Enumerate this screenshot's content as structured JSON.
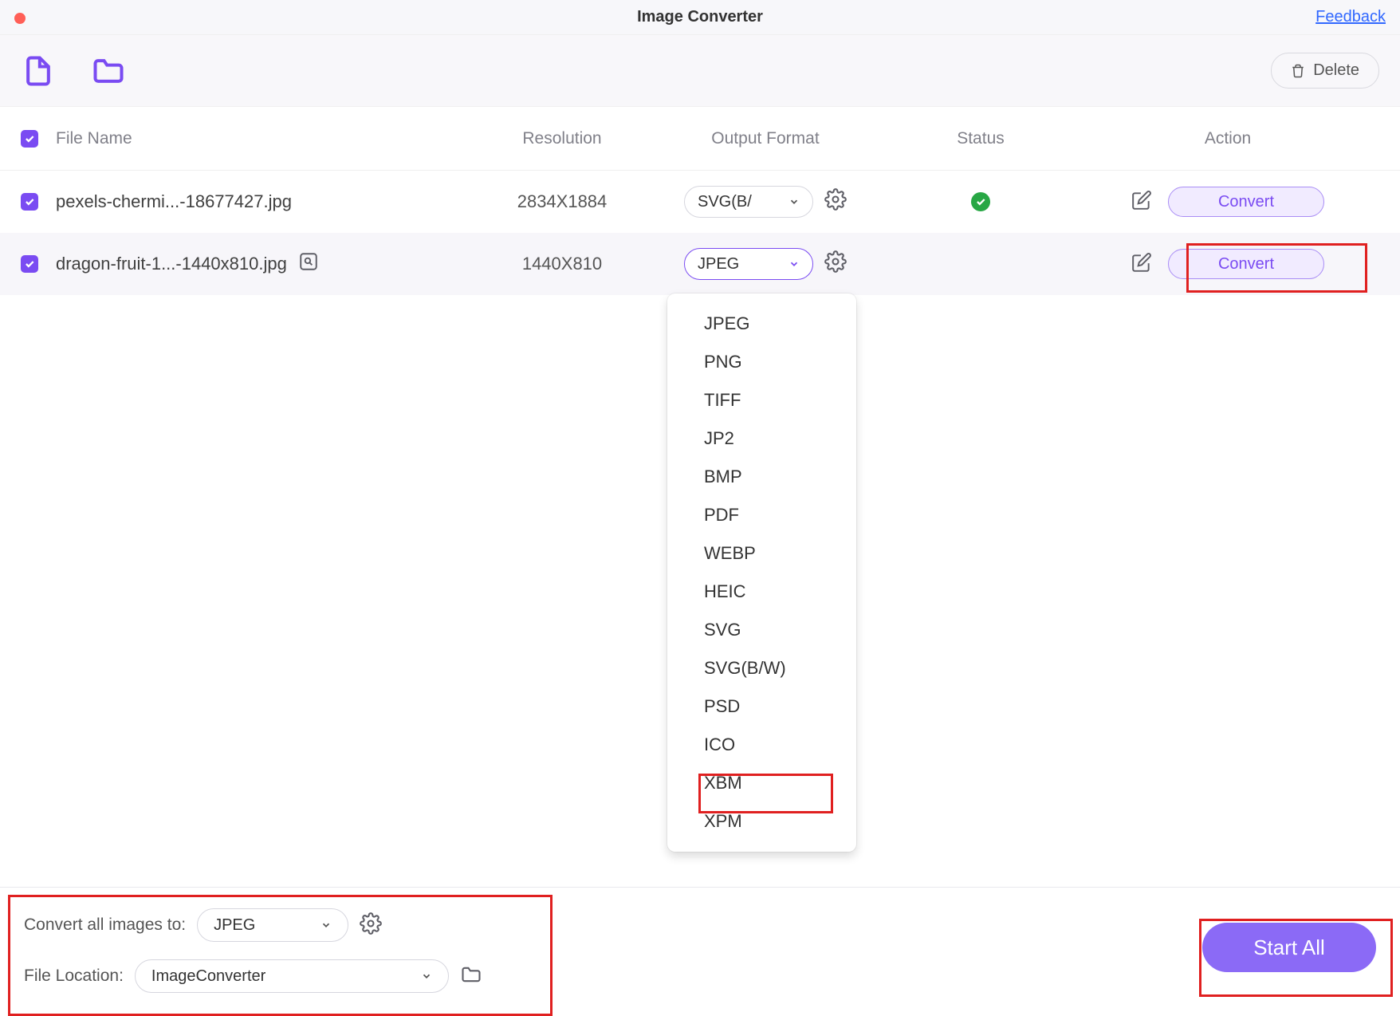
{
  "window": {
    "title": "Image Converter",
    "feedback": "Feedback"
  },
  "toolbar": {
    "delete_label": "Delete"
  },
  "columns": {
    "name": "File Name",
    "resolution": "Resolution",
    "output_format": "Output Format",
    "status": "Status",
    "action": "Action"
  },
  "rows": [
    {
      "checked": true,
      "name": "pexels-chermi...-18677427.jpg",
      "resolution": "2834X1884",
      "format": "SVG(B/",
      "status": "ok",
      "convert_label": "Convert"
    },
    {
      "checked": true,
      "name": "dragon-fruit-1...-1440x810.jpg",
      "resolution": "1440X810",
      "format": "JPEG",
      "status": "",
      "convert_label": "Convert"
    }
  ],
  "dropdown": {
    "options": [
      "JPEG",
      "PNG",
      "TIFF",
      "JP2",
      "BMP",
      "PDF",
      "WEBP",
      "HEIC",
      "SVG",
      "SVG(B/W)",
      "PSD",
      "ICO",
      "XBM",
      "XPM"
    ]
  },
  "bottom": {
    "convert_all_label": "Convert all images to:",
    "convert_all_value": "JPEG",
    "location_label": "File Location:",
    "location_value": "ImageConverter",
    "start_label": "Start  All"
  }
}
